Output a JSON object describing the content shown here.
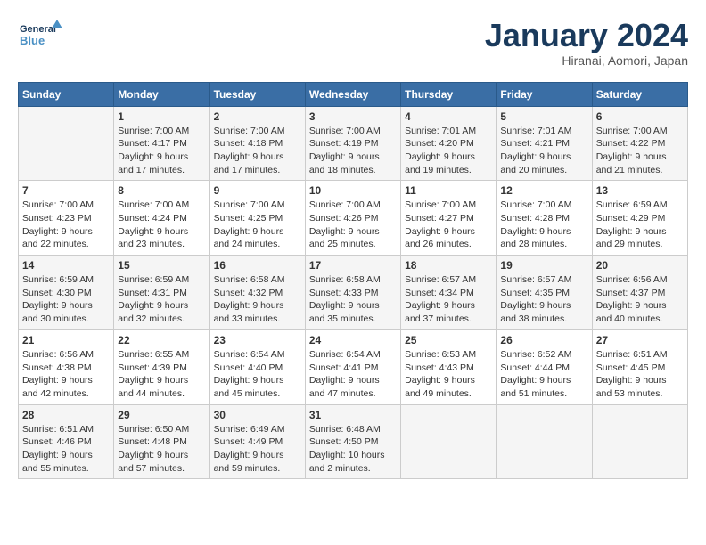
{
  "header": {
    "logo_line1": "General",
    "logo_line2": "Blue",
    "month_title": "January 2024",
    "location": "Hiranai, Aomori, Japan"
  },
  "days_of_week": [
    "Sunday",
    "Monday",
    "Tuesday",
    "Wednesday",
    "Thursday",
    "Friday",
    "Saturday"
  ],
  "weeks": [
    [
      {
        "day": "",
        "info": ""
      },
      {
        "day": "1",
        "info": "Sunrise: 7:00 AM\nSunset: 4:17 PM\nDaylight: 9 hours\nand 17 minutes."
      },
      {
        "day": "2",
        "info": "Sunrise: 7:00 AM\nSunset: 4:18 PM\nDaylight: 9 hours\nand 17 minutes."
      },
      {
        "day": "3",
        "info": "Sunrise: 7:00 AM\nSunset: 4:19 PM\nDaylight: 9 hours\nand 18 minutes."
      },
      {
        "day": "4",
        "info": "Sunrise: 7:01 AM\nSunset: 4:20 PM\nDaylight: 9 hours\nand 19 minutes."
      },
      {
        "day": "5",
        "info": "Sunrise: 7:01 AM\nSunset: 4:21 PM\nDaylight: 9 hours\nand 20 minutes."
      },
      {
        "day": "6",
        "info": "Sunrise: 7:00 AM\nSunset: 4:22 PM\nDaylight: 9 hours\nand 21 minutes."
      }
    ],
    [
      {
        "day": "7",
        "info": "Sunrise: 7:00 AM\nSunset: 4:23 PM\nDaylight: 9 hours\nand 22 minutes."
      },
      {
        "day": "8",
        "info": "Sunrise: 7:00 AM\nSunset: 4:24 PM\nDaylight: 9 hours\nand 23 minutes."
      },
      {
        "day": "9",
        "info": "Sunrise: 7:00 AM\nSunset: 4:25 PM\nDaylight: 9 hours\nand 24 minutes."
      },
      {
        "day": "10",
        "info": "Sunrise: 7:00 AM\nSunset: 4:26 PM\nDaylight: 9 hours\nand 25 minutes."
      },
      {
        "day": "11",
        "info": "Sunrise: 7:00 AM\nSunset: 4:27 PM\nDaylight: 9 hours\nand 26 minutes."
      },
      {
        "day": "12",
        "info": "Sunrise: 7:00 AM\nSunset: 4:28 PM\nDaylight: 9 hours\nand 28 minutes."
      },
      {
        "day": "13",
        "info": "Sunrise: 6:59 AM\nSunset: 4:29 PM\nDaylight: 9 hours\nand 29 minutes."
      }
    ],
    [
      {
        "day": "14",
        "info": "Sunrise: 6:59 AM\nSunset: 4:30 PM\nDaylight: 9 hours\nand 30 minutes."
      },
      {
        "day": "15",
        "info": "Sunrise: 6:59 AM\nSunset: 4:31 PM\nDaylight: 9 hours\nand 32 minutes."
      },
      {
        "day": "16",
        "info": "Sunrise: 6:58 AM\nSunset: 4:32 PM\nDaylight: 9 hours\nand 33 minutes."
      },
      {
        "day": "17",
        "info": "Sunrise: 6:58 AM\nSunset: 4:33 PM\nDaylight: 9 hours\nand 35 minutes."
      },
      {
        "day": "18",
        "info": "Sunrise: 6:57 AM\nSunset: 4:34 PM\nDaylight: 9 hours\nand 37 minutes."
      },
      {
        "day": "19",
        "info": "Sunrise: 6:57 AM\nSunset: 4:35 PM\nDaylight: 9 hours\nand 38 minutes."
      },
      {
        "day": "20",
        "info": "Sunrise: 6:56 AM\nSunset: 4:37 PM\nDaylight: 9 hours\nand 40 minutes."
      }
    ],
    [
      {
        "day": "21",
        "info": "Sunrise: 6:56 AM\nSunset: 4:38 PM\nDaylight: 9 hours\nand 42 minutes."
      },
      {
        "day": "22",
        "info": "Sunrise: 6:55 AM\nSunset: 4:39 PM\nDaylight: 9 hours\nand 44 minutes."
      },
      {
        "day": "23",
        "info": "Sunrise: 6:54 AM\nSunset: 4:40 PM\nDaylight: 9 hours\nand 45 minutes."
      },
      {
        "day": "24",
        "info": "Sunrise: 6:54 AM\nSunset: 4:41 PM\nDaylight: 9 hours\nand 47 minutes."
      },
      {
        "day": "25",
        "info": "Sunrise: 6:53 AM\nSunset: 4:43 PM\nDaylight: 9 hours\nand 49 minutes."
      },
      {
        "day": "26",
        "info": "Sunrise: 6:52 AM\nSunset: 4:44 PM\nDaylight: 9 hours\nand 51 minutes."
      },
      {
        "day": "27",
        "info": "Sunrise: 6:51 AM\nSunset: 4:45 PM\nDaylight: 9 hours\nand 53 minutes."
      }
    ],
    [
      {
        "day": "28",
        "info": "Sunrise: 6:51 AM\nSunset: 4:46 PM\nDaylight: 9 hours\nand 55 minutes."
      },
      {
        "day": "29",
        "info": "Sunrise: 6:50 AM\nSunset: 4:48 PM\nDaylight: 9 hours\nand 57 minutes."
      },
      {
        "day": "30",
        "info": "Sunrise: 6:49 AM\nSunset: 4:49 PM\nDaylight: 9 hours\nand 59 minutes."
      },
      {
        "day": "31",
        "info": "Sunrise: 6:48 AM\nSunset: 4:50 PM\nDaylight: 10 hours\nand 2 minutes."
      },
      {
        "day": "",
        "info": ""
      },
      {
        "day": "",
        "info": ""
      },
      {
        "day": "",
        "info": ""
      }
    ]
  ]
}
